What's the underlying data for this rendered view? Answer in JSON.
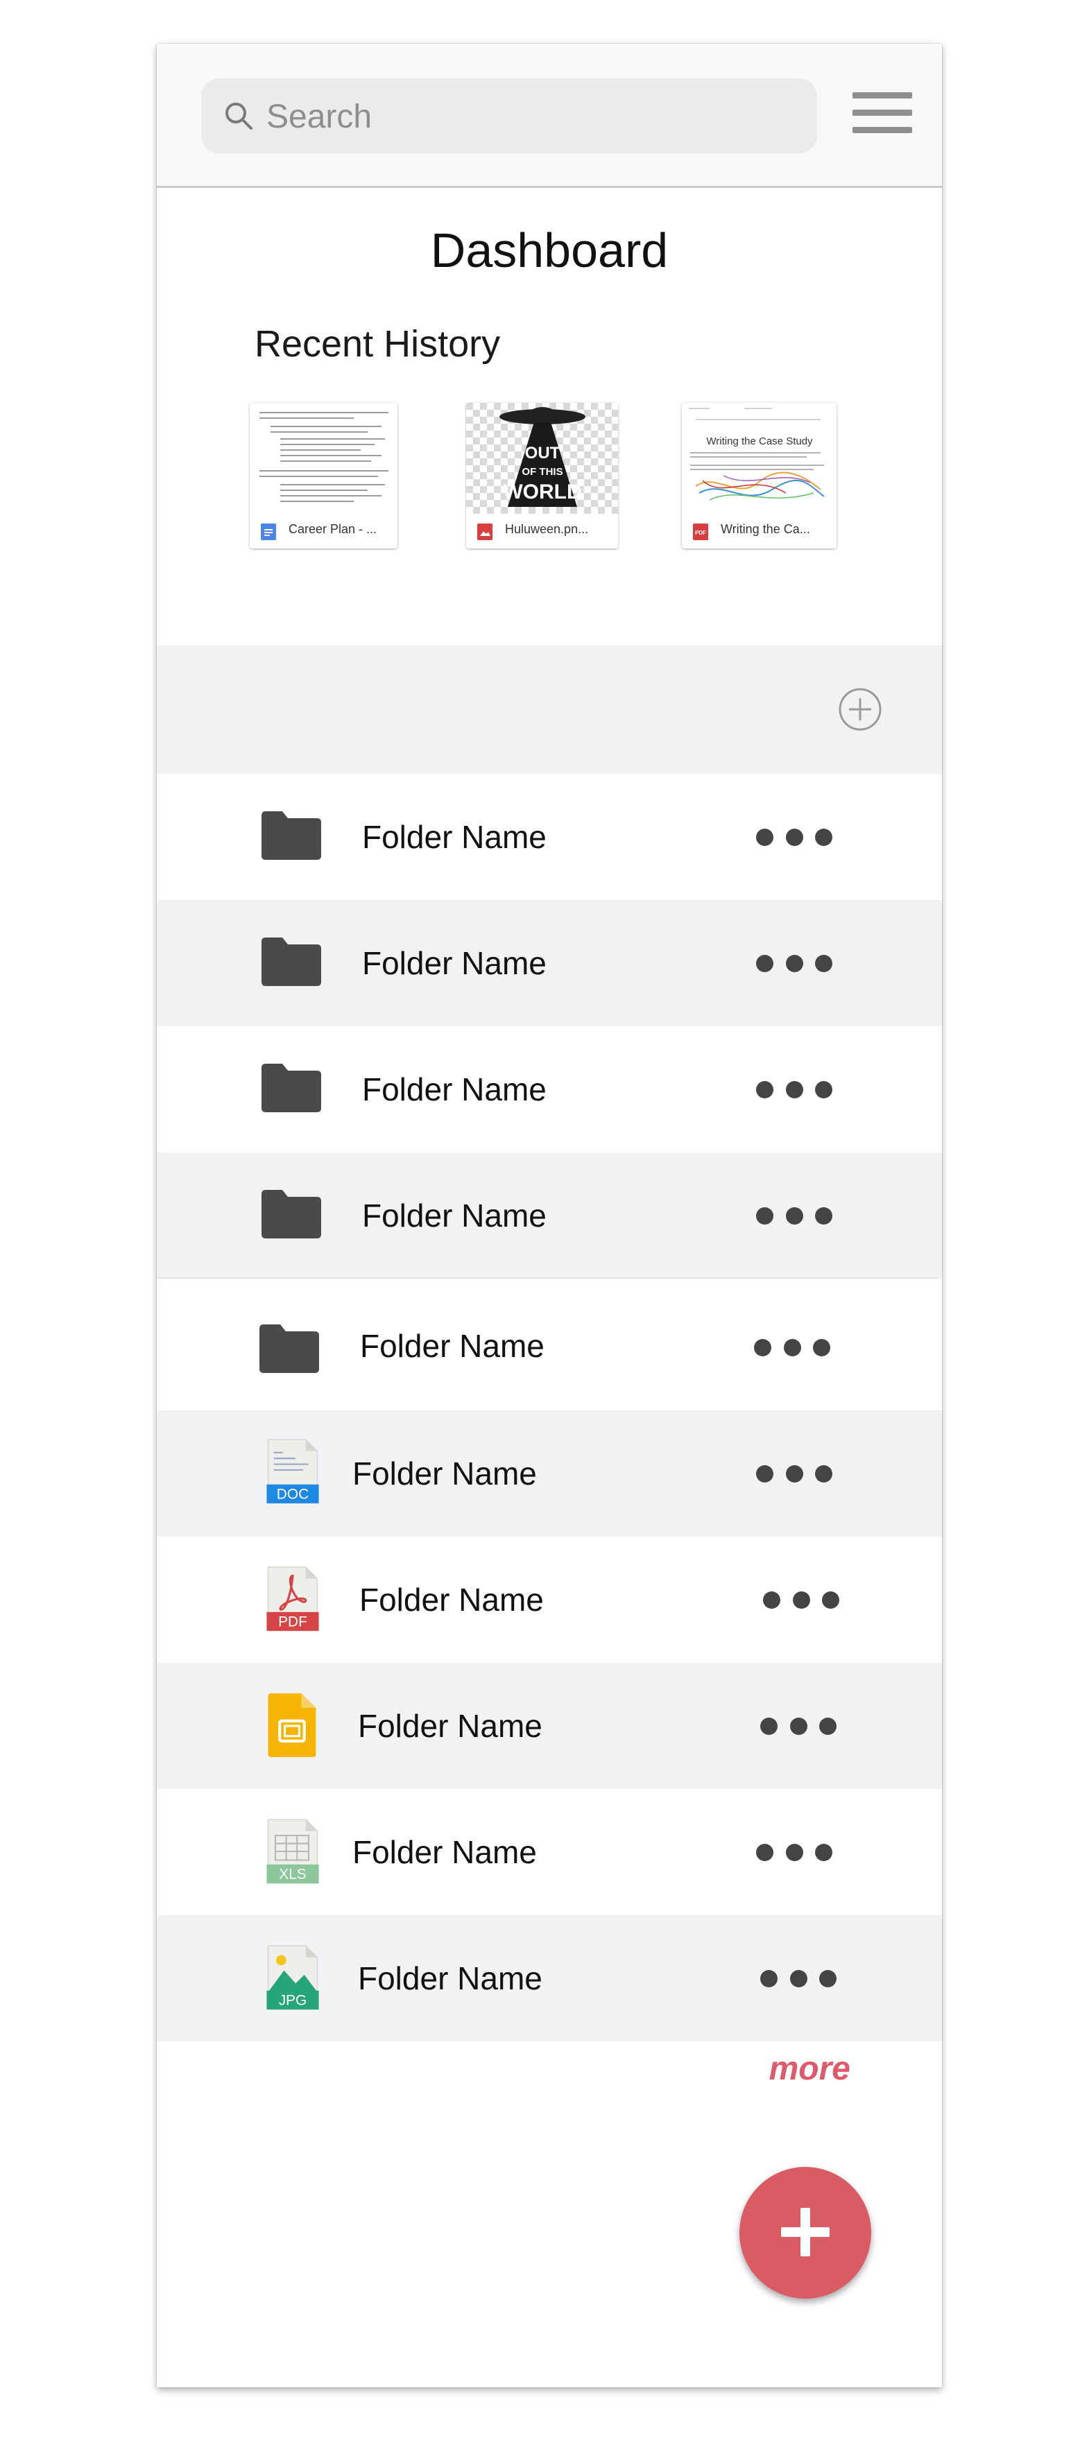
{
  "search": {
    "placeholder": "Search"
  },
  "page_title": "Dashboard",
  "recent_history": {
    "title": "Recent History",
    "items": [
      {
        "label": "Career Plan - ...",
        "type_icon": "google-doc-icon"
      },
      {
        "label": "Huluween.pn...",
        "type_icon": "image-file-icon",
        "preview_text": [
          "OUT",
          "OF THIS",
          "WORLD"
        ]
      },
      {
        "label": "Writing the Ca...",
        "type_icon": "pdf-file-icon",
        "preview_text": "Writing the Case Study"
      }
    ]
  },
  "items": [
    {
      "name": "Folder Name",
      "icon": "folder-icon"
    },
    {
      "name": "Folder Name",
      "icon": "folder-icon"
    },
    {
      "name": "Folder Name",
      "icon": "folder-icon"
    },
    {
      "name": "Folder Name",
      "icon": "folder-icon"
    },
    {
      "name": "Folder Name",
      "icon": "folder-icon"
    },
    {
      "name": "Folder Name",
      "icon": "doc-file-icon",
      "badge": "DOC"
    },
    {
      "name": "Folder Name",
      "icon": "pdf-file-icon",
      "badge": "PDF"
    },
    {
      "name": "Folder Name",
      "icon": "slides-file-icon"
    },
    {
      "name": "Folder Name",
      "icon": "xls-file-icon",
      "badge": "XLS"
    },
    {
      "name": "Folder Name",
      "icon": "jpg-file-icon",
      "badge": "JPG"
    }
  ],
  "more_label": "more",
  "colors": {
    "accent": "#d95c64",
    "more_text": "#de5a6a",
    "folder": "#4a4a4a",
    "row_gray": "#f1f2f4",
    "doc_badge": "#1e88e5",
    "pdf_badge": "#d64545",
    "slides": "#f5b400",
    "xls_badge": "#8bc79a",
    "jpg_badge": "#26a47a"
  }
}
